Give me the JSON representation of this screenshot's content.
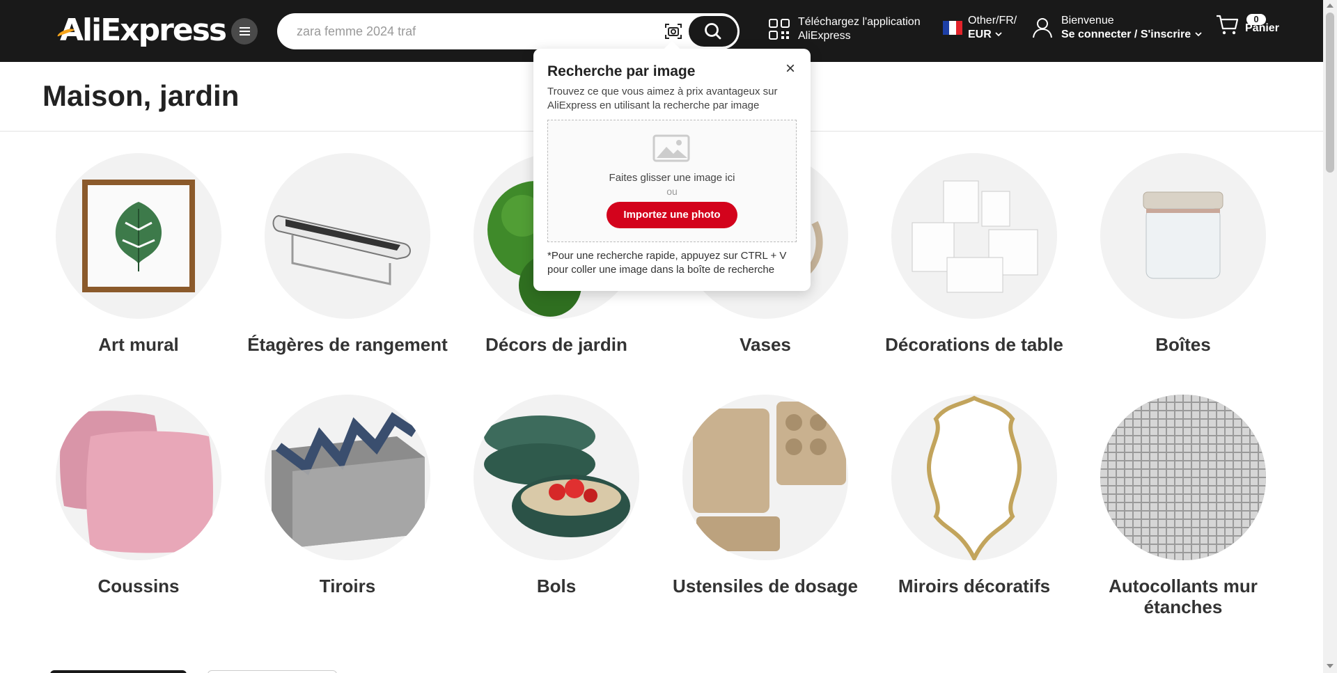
{
  "header": {
    "logo_text": "AliExpress",
    "search": {
      "value": "",
      "placeholder": "zara femme 2024 traf"
    },
    "app_download": {
      "line1": "Téléchargez l'application",
      "line2": "AliExpress"
    },
    "locale": {
      "line1": "Other/FR/",
      "currency": "EUR"
    },
    "user": {
      "greeting": "Bienvenue",
      "action": "Se connecter / S'inscrire"
    },
    "cart": {
      "count": "0",
      "label": "Panier"
    }
  },
  "page": {
    "title": "Maison, jardin"
  },
  "categories": [
    {
      "label": "Art mural"
    },
    {
      "label": "Étagères de rangement"
    },
    {
      "label": "Décors de jardin"
    },
    {
      "label": "Vases"
    },
    {
      "label": "Décorations de table"
    },
    {
      "label": "Boîtes"
    },
    {
      "label": "Coussins"
    },
    {
      "label": "Tiroirs"
    },
    {
      "label": "Bols"
    },
    {
      "label": "Ustensiles de dosage"
    },
    {
      "label": "Miroirs décoratifs"
    },
    {
      "label": "Autocollants mur étanches"
    }
  ],
  "image_search_popup": {
    "title": "Recherche par image",
    "close_symbol": "×",
    "description": "Trouvez ce que vous aimez à prix avantageux sur AliExpress en utilisant la recherche par image",
    "drag_text": "Faites glisser une image ici",
    "or_text": "ou",
    "upload_label": "Importez une photo",
    "hint": "*Pour une recherche rapide, appuyez sur CTRL + V pour coller une image dans la boîte de recherche"
  },
  "colors": {
    "header_bg": "#191919",
    "accent_red": "#d3031c",
    "logo_accent": "#f7a51c"
  },
  "icons": [
    "menu-icon",
    "camera-search-icon",
    "search-icon",
    "qr-code-icon",
    "france-flag-icon",
    "chevron-down-icon",
    "user-icon",
    "cart-icon",
    "close-icon",
    "image-placeholder-icon"
  ]
}
